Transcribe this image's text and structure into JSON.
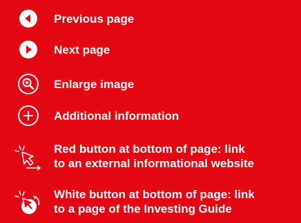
{
  "legend": {
    "items": [
      {
        "icon": "previous-page-icon",
        "label": "Previous page"
      },
      {
        "icon": "next-page-icon",
        "label": "Next page"
      },
      {
        "icon": "enlarge-image-icon",
        "label": "Enlarge image"
      },
      {
        "icon": "additional-information-icon",
        "label": "Additional information"
      },
      {
        "icon": "red-button-cursor-icon",
        "line1": "Red button at bottom of page: link",
        "line2": "to an external informational website"
      },
      {
        "icon": "white-button-cursor-icon",
        "line1": "White button at bottom of page: link",
        "line2": "to a page of the Investing Guide"
      }
    ]
  },
  "colors": {
    "background": "#e30613",
    "foreground": "#ffffff"
  }
}
